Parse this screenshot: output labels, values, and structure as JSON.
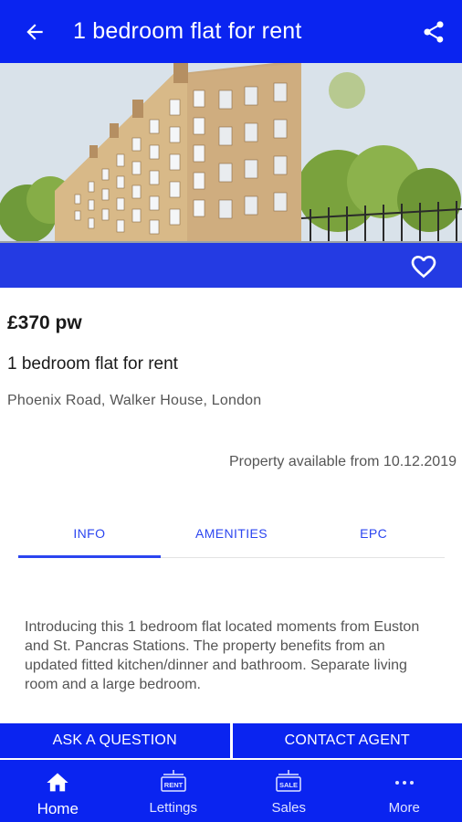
{
  "appbar": {
    "title": "1 bedroom flat for rent",
    "back_icon": "arrow-left-icon",
    "share_icon": "share-icon"
  },
  "hero": {
    "favorite_icon": "heart-outline-icon"
  },
  "listing": {
    "price": "£370 pw",
    "title": "1 bedroom flat for rent",
    "address": "Phoenix Road, Walker House, London",
    "availability": "Property available from 10.12.2019"
  },
  "tabs": [
    {
      "label": "INFO",
      "active": true
    },
    {
      "label": "AMENITIES",
      "active": false
    },
    {
      "label": "EPC",
      "active": false
    }
  ],
  "description": "Introducing this 1 bedroom flat located moments from Euston and St. Pancras Stations. The property benefits from an updated fitted kitchen/dinner and bathroom. Separate living room and a large bedroom.",
  "actions": {
    "ask": "ASK A QUESTION",
    "contact": "CONTACT AGENT"
  },
  "bottom_nav": [
    {
      "label": "Home",
      "icon": "home-icon",
      "active": true
    },
    {
      "label": "Lettings",
      "icon": "rent-sign-icon",
      "active": false
    },
    {
      "label": "Sales",
      "icon": "sale-sign-icon",
      "active": false
    },
    {
      "label": "More",
      "icon": "more-dots-icon",
      "active": false
    }
  ],
  "colors": {
    "primary": "#0a24f0",
    "tab_text": "#2b45f0",
    "body_text": "#555555"
  }
}
